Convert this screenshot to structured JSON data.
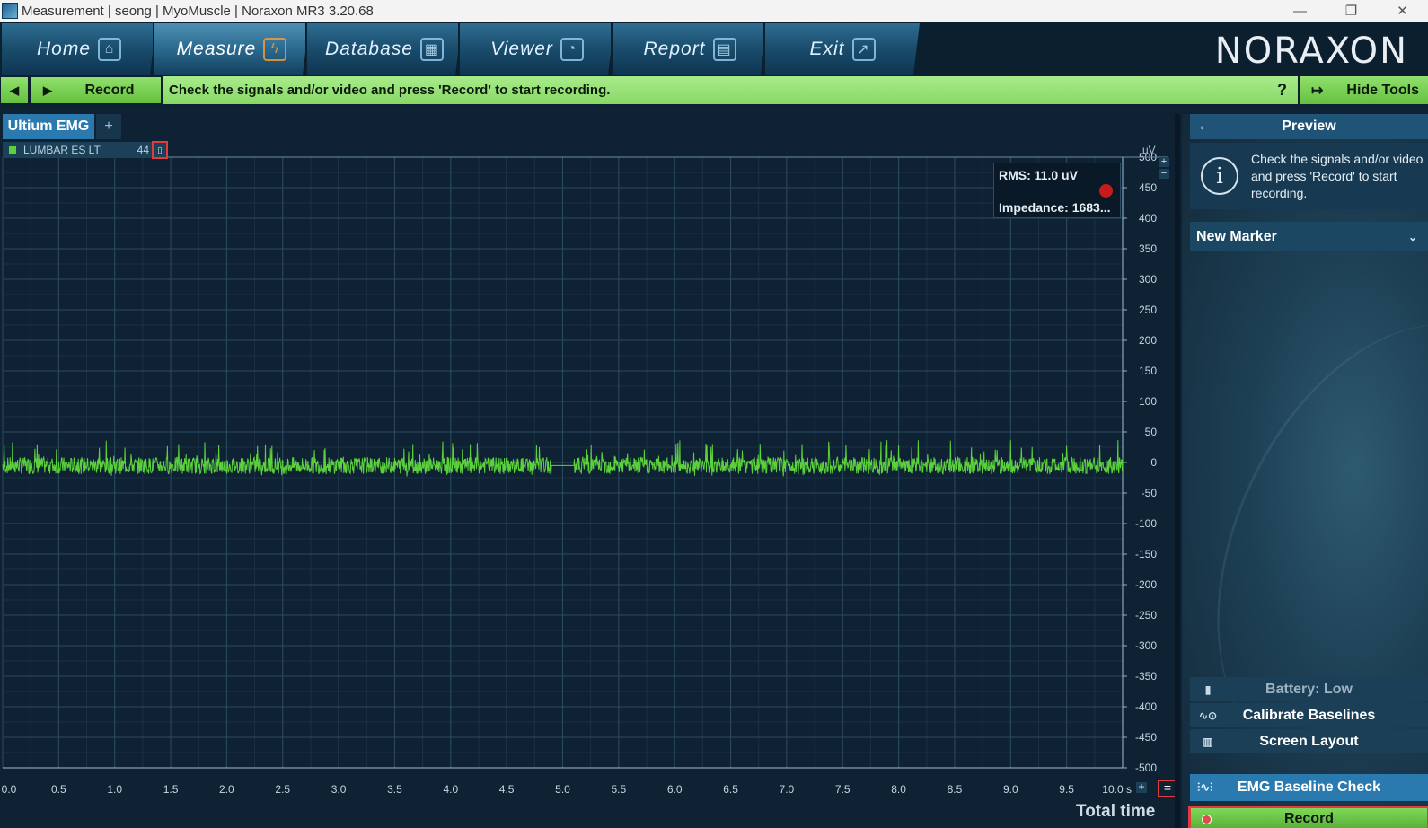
{
  "window": {
    "title": "Measurement | seong | MyoMuscle | Noraxon MR3 3.20.68",
    "controls": [
      "—",
      "❐",
      "✕"
    ]
  },
  "nav": {
    "tabs": [
      {
        "label": "Home",
        "icon": "home-icon",
        "glyph": "⌂"
      },
      {
        "label": "Measure",
        "icon": "measure-icon",
        "glyph": "ϟ"
      },
      {
        "label": "Database",
        "icon": "database-icon",
        "glyph": "▦"
      },
      {
        "label": "Viewer",
        "icon": "viewer-icon",
        "glyph": "◔"
      },
      {
        "label": "Report",
        "icon": "report-icon",
        "glyph": "▤"
      },
      {
        "label": "Exit",
        "icon": "exit-icon",
        "glyph": "↗"
      }
    ],
    "active": "Measure",
    "logo": "NORAXON"
  },
  "command_bar": {
    "prev_icon": "◀",
    "play_icon": "▶",
    "record_label": "Record",
    "message": "Check the signals and/or video and press 'Record' to start recording.",
    "help": "?",
    "hide_tools_label": "Hide Tools",
    "hide_tools_icon": "↦"
  },
  "tabs": {
    "active_label": "Ultium EMG",
    "add": "+"
  },
  "channel": {
    "name": "LUMBAR ES LT",
    "number": "44",
    "color": "#5bd13b",
    "unit": "uV",
    "rms": "RMS: 11.0 uV",
    "impedance": "Impedance: 1683...",
    "status_color": "#c81c1c"
  },
  "plot": {
    "zoom_plus": "+",
    "zoom_minus": "−",
    "zoom_h_plus": "+",
    "zoom_h_minus": "=",
    "total_time_label": "Total time"
  },
  "chart_data": {
    "type": "line",
    "series": [
      {
        "name": "LUMBAR ES LT",
        "color": "#5bd13b"
      }
    ],
    "ylabel": "uV",
    "ylim": [
      -500,
      500
    ],
    "yticks": [
      "500",
      "450",
      "400",
      "350",
      "300",
      "250",
      "200",
      "150",
      "100",
      "50",
      "0",
      "-50",
      "-100",
      "-150",
      "-200",
      "-250",
      "-300",
      "-350",
      "-400",
      "-450",
      "-500"
    ],
    "xlim": [
      0,
      10
    ],
    "xticks": [
      "0.0",
      "0.5",
      "1.0",
      "1.5",
      "2.0",
      "2.5",
      "3.0",
      "3.5",
      "4.0",
      "4.5",
      "5.0",
      "5.5",
      "6.0",
      "6.5",
      "7.0",
      "7.5",
      "8.0",
      "8.5",
      "9.0",
      "9.5",
      "10.0 s"
    ],
    "signal": {
      "baseline_uV": -5,
      "amplitude_uV": 50,
      "gap_start_s": 4.9,
      "gap_end_s": 5.1
    },
    "grid": true
  },
  "right_panel": {
    "header": "Preview",
    "back_icon": "←",
    "info_text": "Check the signals and/or video and press 'Record' to start recording.",
    "info_icon": "i",
    "marker_label": "New Marker",
    "marker_chevron": "⌄",
    "battery": "Battery: Low",
    "calibrate": "Calibrate Baselines",
    "screen_layout": "Screen Layout",
    "emg_check": "EMG Baseline Check",
    "record": "Record"
  }
}
